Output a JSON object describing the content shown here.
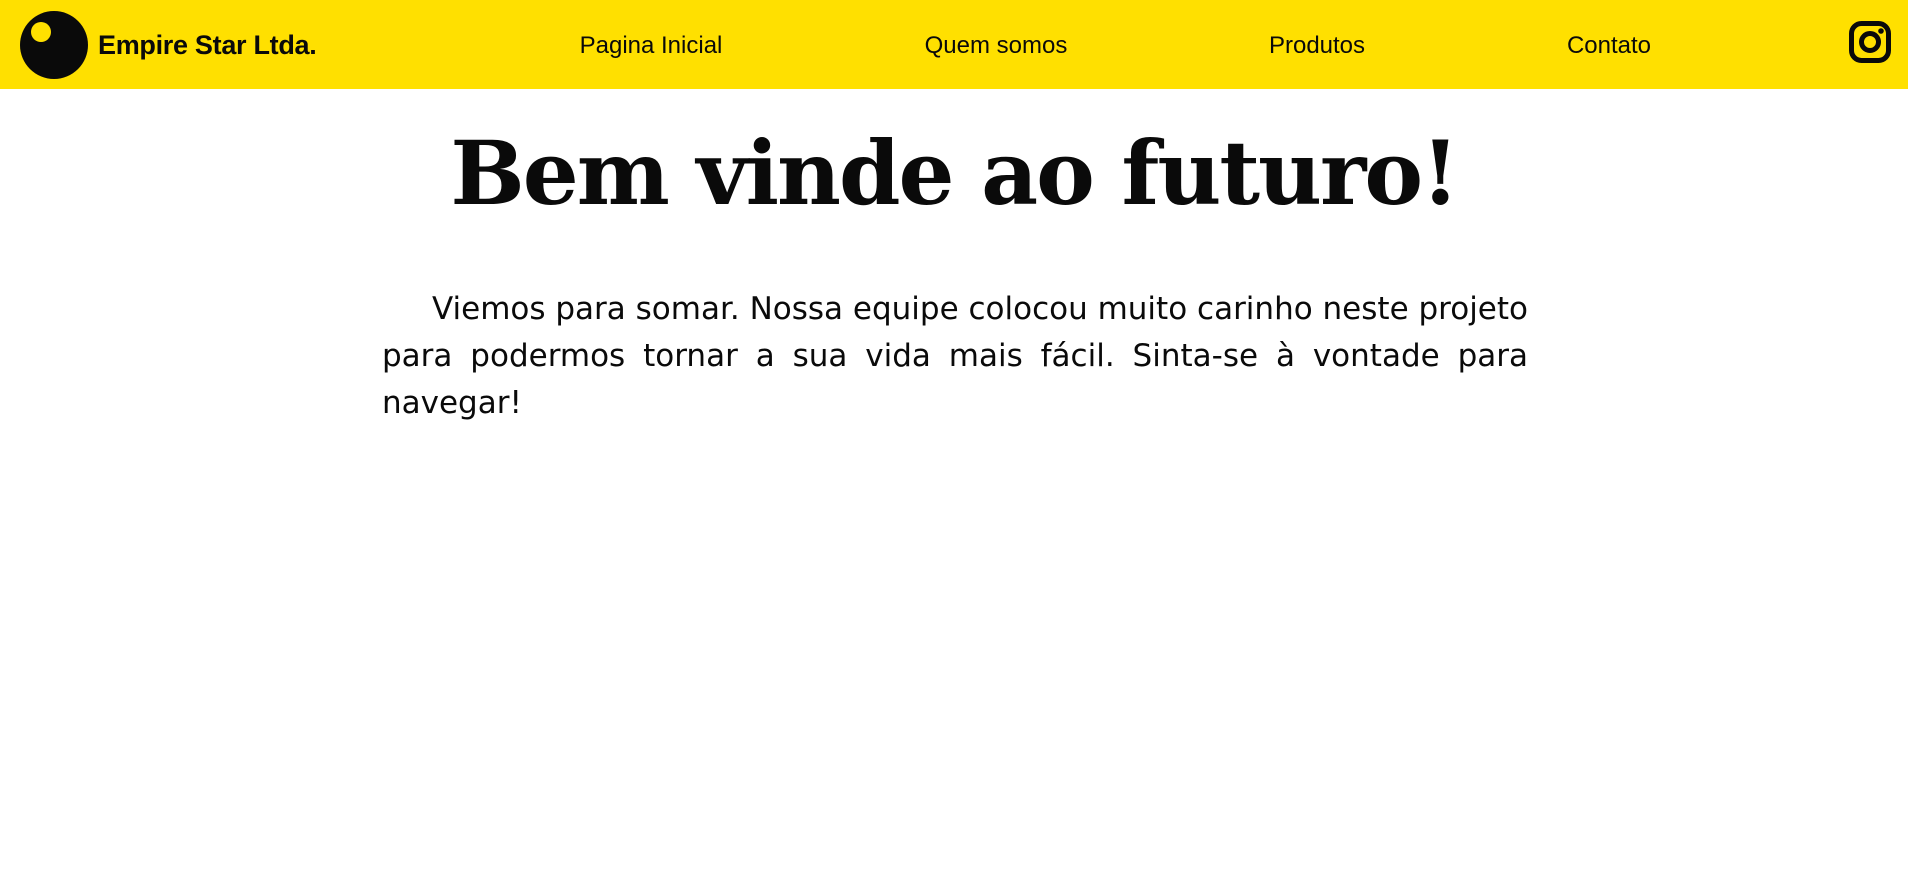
{
  "header": {
    "brand_name": "Empire Star Ltda.",
    "logo_icon": "eclipse-logo-icon",
    "background_color": "#ffe000",
    "nav": [
      {
        "label": "Pagina Inicial"
      },
      {
        "label": "Quem somos"
      },
      {
        "label": "Produtos"
      },
      {
        "label": "Contato"
      }
    ],
    "social_icon": "instagram-icon"
  },
  "main": {
    "title": "Bem vinde ao futuro!",
    "intro": "Viemos para somar. Nossa equipe colocou muito carinho neste projeto para podermos tornar a sua vida mais fácil. Sinta-se à vontade para navegar!"
  },
  "colors": {
    "accent": "#ffe000",
    "text": "#0a0a0a",
    "background": "#ffffff"
  }
}
